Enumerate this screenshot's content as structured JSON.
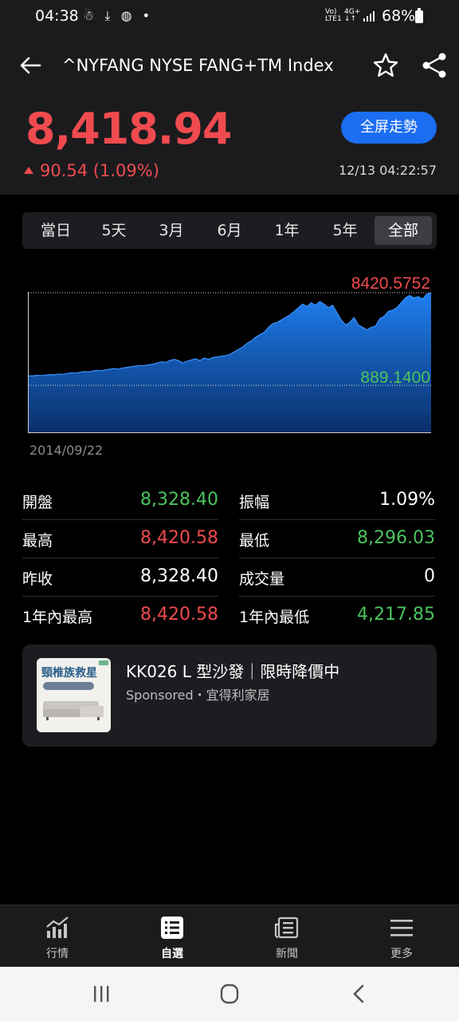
{
  "status_bar": {
    "time": "04:38",
    "icons": "☃ ⤓ ◍ •",
    "net_top": "Vo)",
    "net_bottom": "LTE1",
    "net2_top": "4G+",
    "net2_bottom": "↓↑",
    "battery": "68%"
  },
  "header": {
    "title": "^NYFANG NYSE FANG+TM Index",
    "price": "8,418.94",
    "change": "90.54 (1.09%)",
    "fullscreen_label": "全屏走勢",
    "timestamp": "12/13 04:22:57"
  },
  "range_tabs": [
    {
      "label": "當日",
      "active": false
    },
    {
      "label": "5天",
      "active": false
    },
    {
      "label": "3月",
      "active": false
    },
    {
      "label": "6月",
      "active": false
    },
    {
      "label": "1年",
      "active": false
    },
    {
      "label": "5年",
      "active": false
    },
    {
      "label": "全部",
      "active": true
    }
  ],
  "chart_data": {
    "type": "area",
    "max_label": "8420.5752",
    "min_label": "889.1400",
    "start_label": "2014/09/22",
    "ylim": [
      889.14,
      8420.5752
    ],
    "colors": {
      "fill_top": "#1f7ff0",
      "fill_bottom": "#0a2f6a",
      "max_label": "#ef4b4f",
      "min_label": "#4cc35f"
    },
    "values": [
      1650,
      1660,
      1700,
      1680,
      1720,
      1760,
      1740,
      1800,
      1780,
      1850,
      1900,
      1880,
      1950,
      2000,
      1980,
      2050,
      2100,
      2080,
      2150,
      2200,
      2250,
      2200,
      2300,
      2350,
      2400,
      2450,
      2500,
      2480,
      2550,
      2600,
      2700,
      2800,
      2750,
      2900,
      3000,
      2900,
      2700,
      2850,
      2950,
      3050,
      2900,
      3100,
      3000,
      3150,
      3200,
      3250,
      3300,
      3400,
      3600,
      3800,
      4000,
      4300,
      4500,
      4800,
      5000,
      5200,
      5600,
      5900,
      6000,
      6200,
      6400,
      6600,
      6900,
      7200,
      7500,
      7300,
      7600,
      7400,
      7700,
      7500,
      7200,
      7400,
      6800,
      6200,
      5800,
      6000,
      6400,
      5800,
      5600,
      5400,
      5600,
      5700,
      6300,
      6500,
      6900,
      7000,
      7200,
      7600,
      8000,
      8200,
      8000,
      8100,
      7900,
      8300,
      8420.5752
    ]
  },
  "stats": [
    {
      "label": "開盤",
      "value": "8,328.40",
      "color": "green"
    },
    {
      "label": "振幅",
      "value": "1.09%",
      "color": "white"
    },
    {
      "label": "最高",
      "value": "8,420.58",
      "color": "red"
    },
    {
      "label": "最低",
      "value": "8,296.03",
      "color": "green"
    },
    {
      "label": "昨收",
      "value": "8,328.40",
      "color": "white"
    },
    {
      "label": "成交量",
      "value": "0",
      "color": "white"
    },
    {
      "label": "1年內最高",
      "value": "8,420.58",
      "color": "red"
    },
    {
      "label": "1年內最低",
      "value": "4,217.85",
      "color": "green"
    }
  ],
  "ad": {
    "title": "KK026 L 型沙發｜限時降價中",
    "source": "Sponsored・宜得利家居",
    "thumb_text": "頸椎族救星"
  },
  "bottom_nav": [
    {
      "label": "行情",
      "icon": "chart-icon",
      "active": false
    },
    {
      "label": "自選",
      "icon": "list-icon",
      "active": true
    },
    {
      "label": "新聞",
      "icon": "news-icon",
      "active": false
    },
    {
      "label": "更多",
      "icon": "menu-icon",
      "active": false
    }
  ]
}
